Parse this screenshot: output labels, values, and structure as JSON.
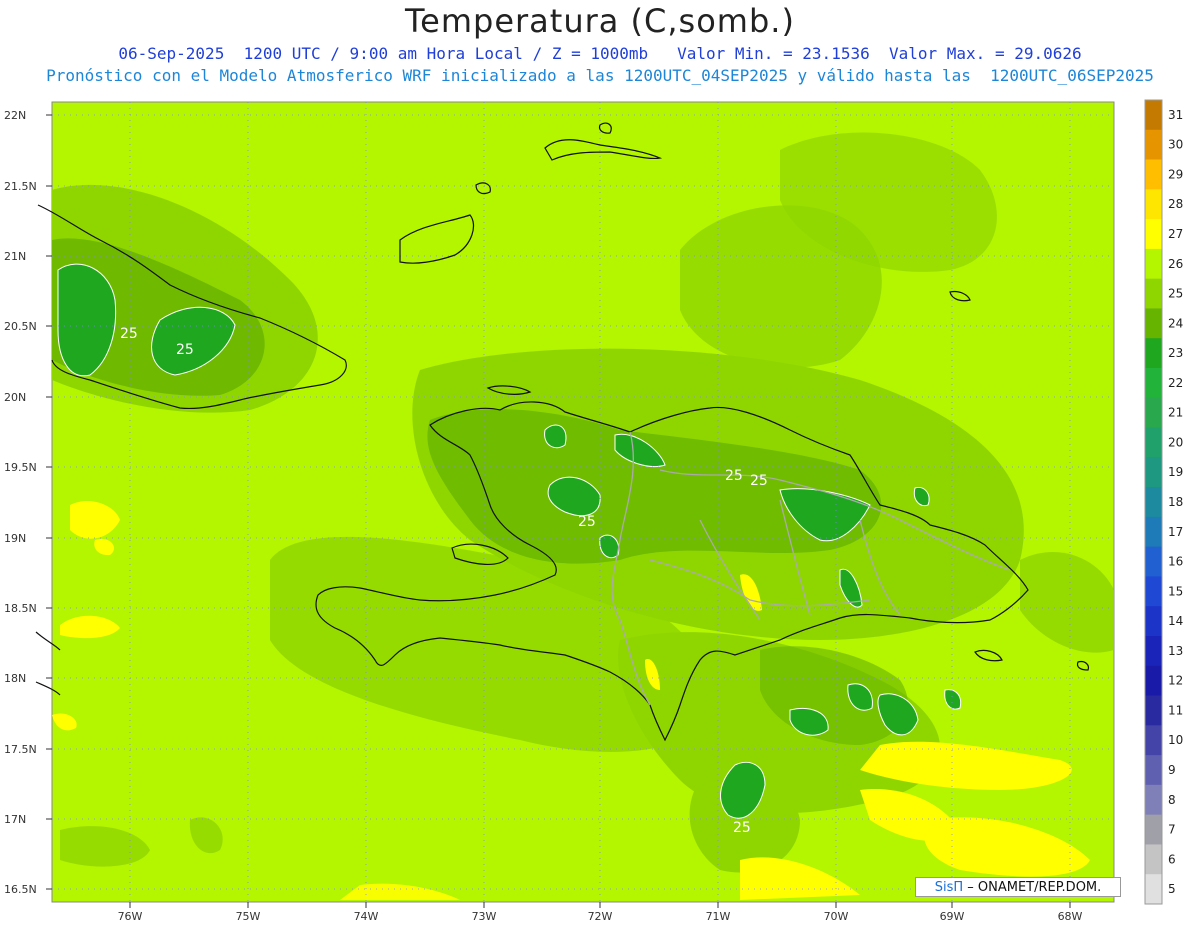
{
  "header": {
    "title": "Temperatura (C,somb.)",
    "line1": "06-Sep-2025  1200 UTC / 9:00 am Hora Local / Z = 1000mb   Valor Min. = 23.1536  Valor Max. = 29.0626",
    "line2": "Pronóstico con el Modelo Atmosferico WRF inicializado a las 1200UTC_04SEP2025 y válido hasta las  1200UTC_06SEP2025"
  },
  "axes": {
    "lat_labels": [
      "22N",
      "21.5N",
      "21N",
      "20.5N",
      "20N",
      "19.5N",
      "19N",
      "18.5N",
      "18N",
      "17.5N",
      "17N",
      "16.5N"
    ],
    "lon_labels": [
      "76W",
      "75W",
      "74W",
      "73W",
      "72W",
      "71W",
      "70W",
      "69W",
      "68W"
    ]
  },
  "contour_labels": [
    "25",
    "25",
    "25",
    "25",
    "25",
    "25"
  ],
  "colorbar": {
    "labels": [
      "31",
      "30",
      "29",
      "28",
      "27",
      "26",
      "25",
      "24",
      "23",
      "22",
      "21",
      "20",
      "19",
      "18",
      "17",
      "16",
      "15",
      "14",
      "13",
      "12",
      "11",
      "10",
      "9",
      "8",
      "7",
      "6",
      "5"
    ],
    "colors": [
      "#c47a00",
      "#e69500",
      "#ffbf00",
      "#ffe600",
      "#ffff00",
      "#b4f500",
      "#8fd600",
      "#66b300",
      "#1fa81f",
      "#22b43a",
      "#2aa84e",
      "#20a06a",
      "#1e9880",
      "#1d8aa0",
      "#1f7ab8",
      "#2060d0",
      "#1f48d4",
      "#1c35c8",
      "#1a24b8",
      "#1a1aa8",
      "#2a2aa0",
      "#4444a8",
      "#6060b0",
      "#8080b8",
      "#a0a0a8",
      "#c4c4c4",
      "#e0e0e0"
    ]
  },
  "credit": {
    "sis": "SisΠ",
    "rest": " – ONAMET/REP.DOM."
  },
  "colors": {
    "background_field": "#b4f500",
    "warm": "#ffff00",
    "cool": "#8fd600",
    "coolest": "#66b300",
    "contour25": "#1fa81f"
  }
}
